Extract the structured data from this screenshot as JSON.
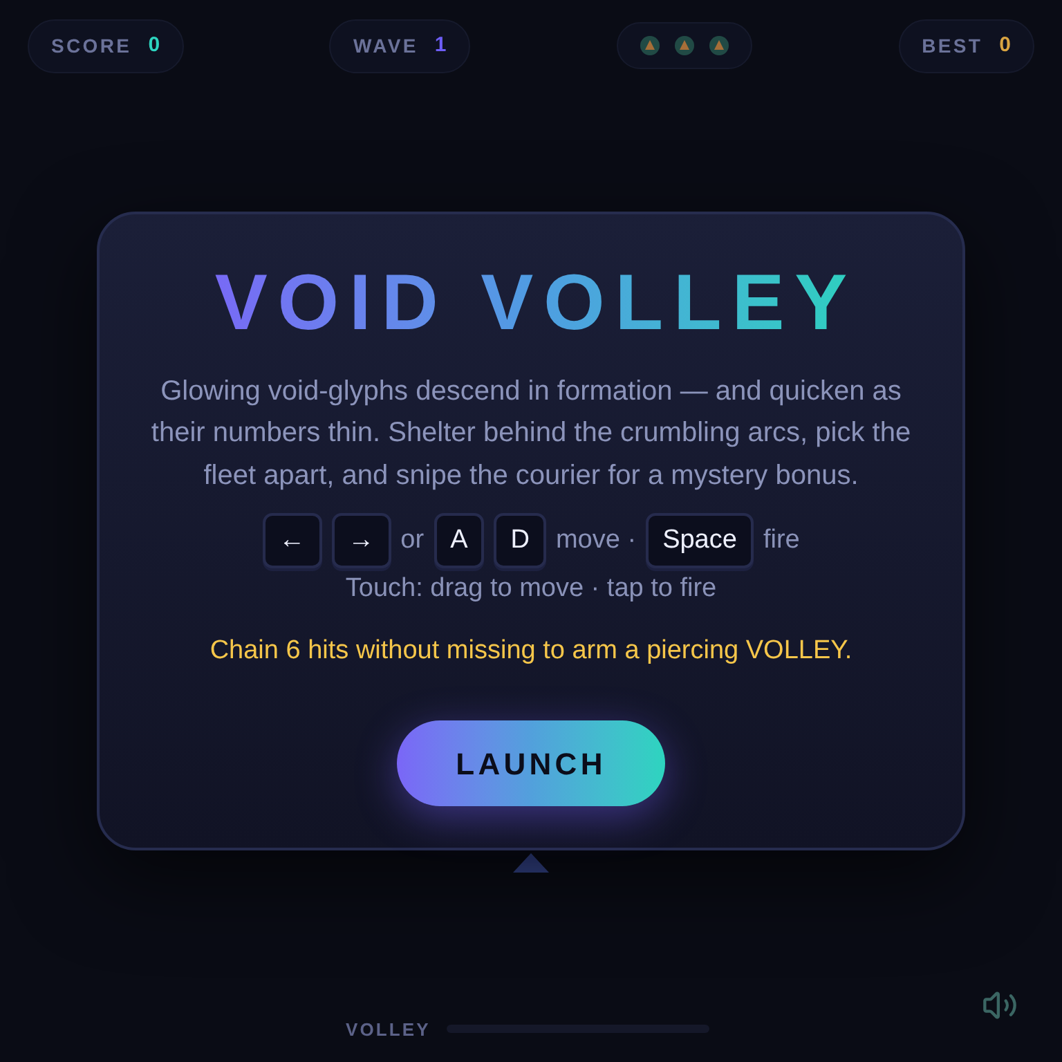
{
  "hud": {
    "score": {
      "label": "SCORE",
      "value": "0",
      "color": "#2dd4bf"
    },
    "wave": {
      "label": "WAVE",
      "value": "1",
      "color": "#6d5df5"
    },
    "lives": [
      {
        "on": true
      },
      {
        "on": true
      },
      {
        "on": true
      }
    ],
    "best": {
      "label": "BEST",
      "value": "0",
      "color": "#d9a441"
    }
  },
  "overlay": {
    "title": "VOID VOLLEY",
    "description": "Glowing void-glyphs descend in formation — and quicken as their numbers thin. Shelter behind the crumbling arcs, pick the fleet apart, and snipe the courier for a mystery bonus.",
    "controls": [
      {
        "kind": "key",
        "text": "←"
      },
      {
        "kind": "key",
        "text": "→"
      },
      {
        "kind": "text",
        "text": "or"
      },
      {
        "kind": "key",
        "text": "A"
      },
      {
        "kind": "key",
        "text": "D"
      },
      {
        "kind": "text",
        "text": "move ·"
      },
      {
        "kind": "key",
        "text": "Space"
      },
      {
        "kind": "text",
        "text": "fire"
      }
    ],
    "touch_hint": "Touch: drag to move · tap to fire",
    "tip": "Chain 6 hits without missing to arm a piercing VOLLEY.",
    "button": "LAUNCH"
  },
  "footer": {
    "meter_label": "VOLLEY"
  }
}
